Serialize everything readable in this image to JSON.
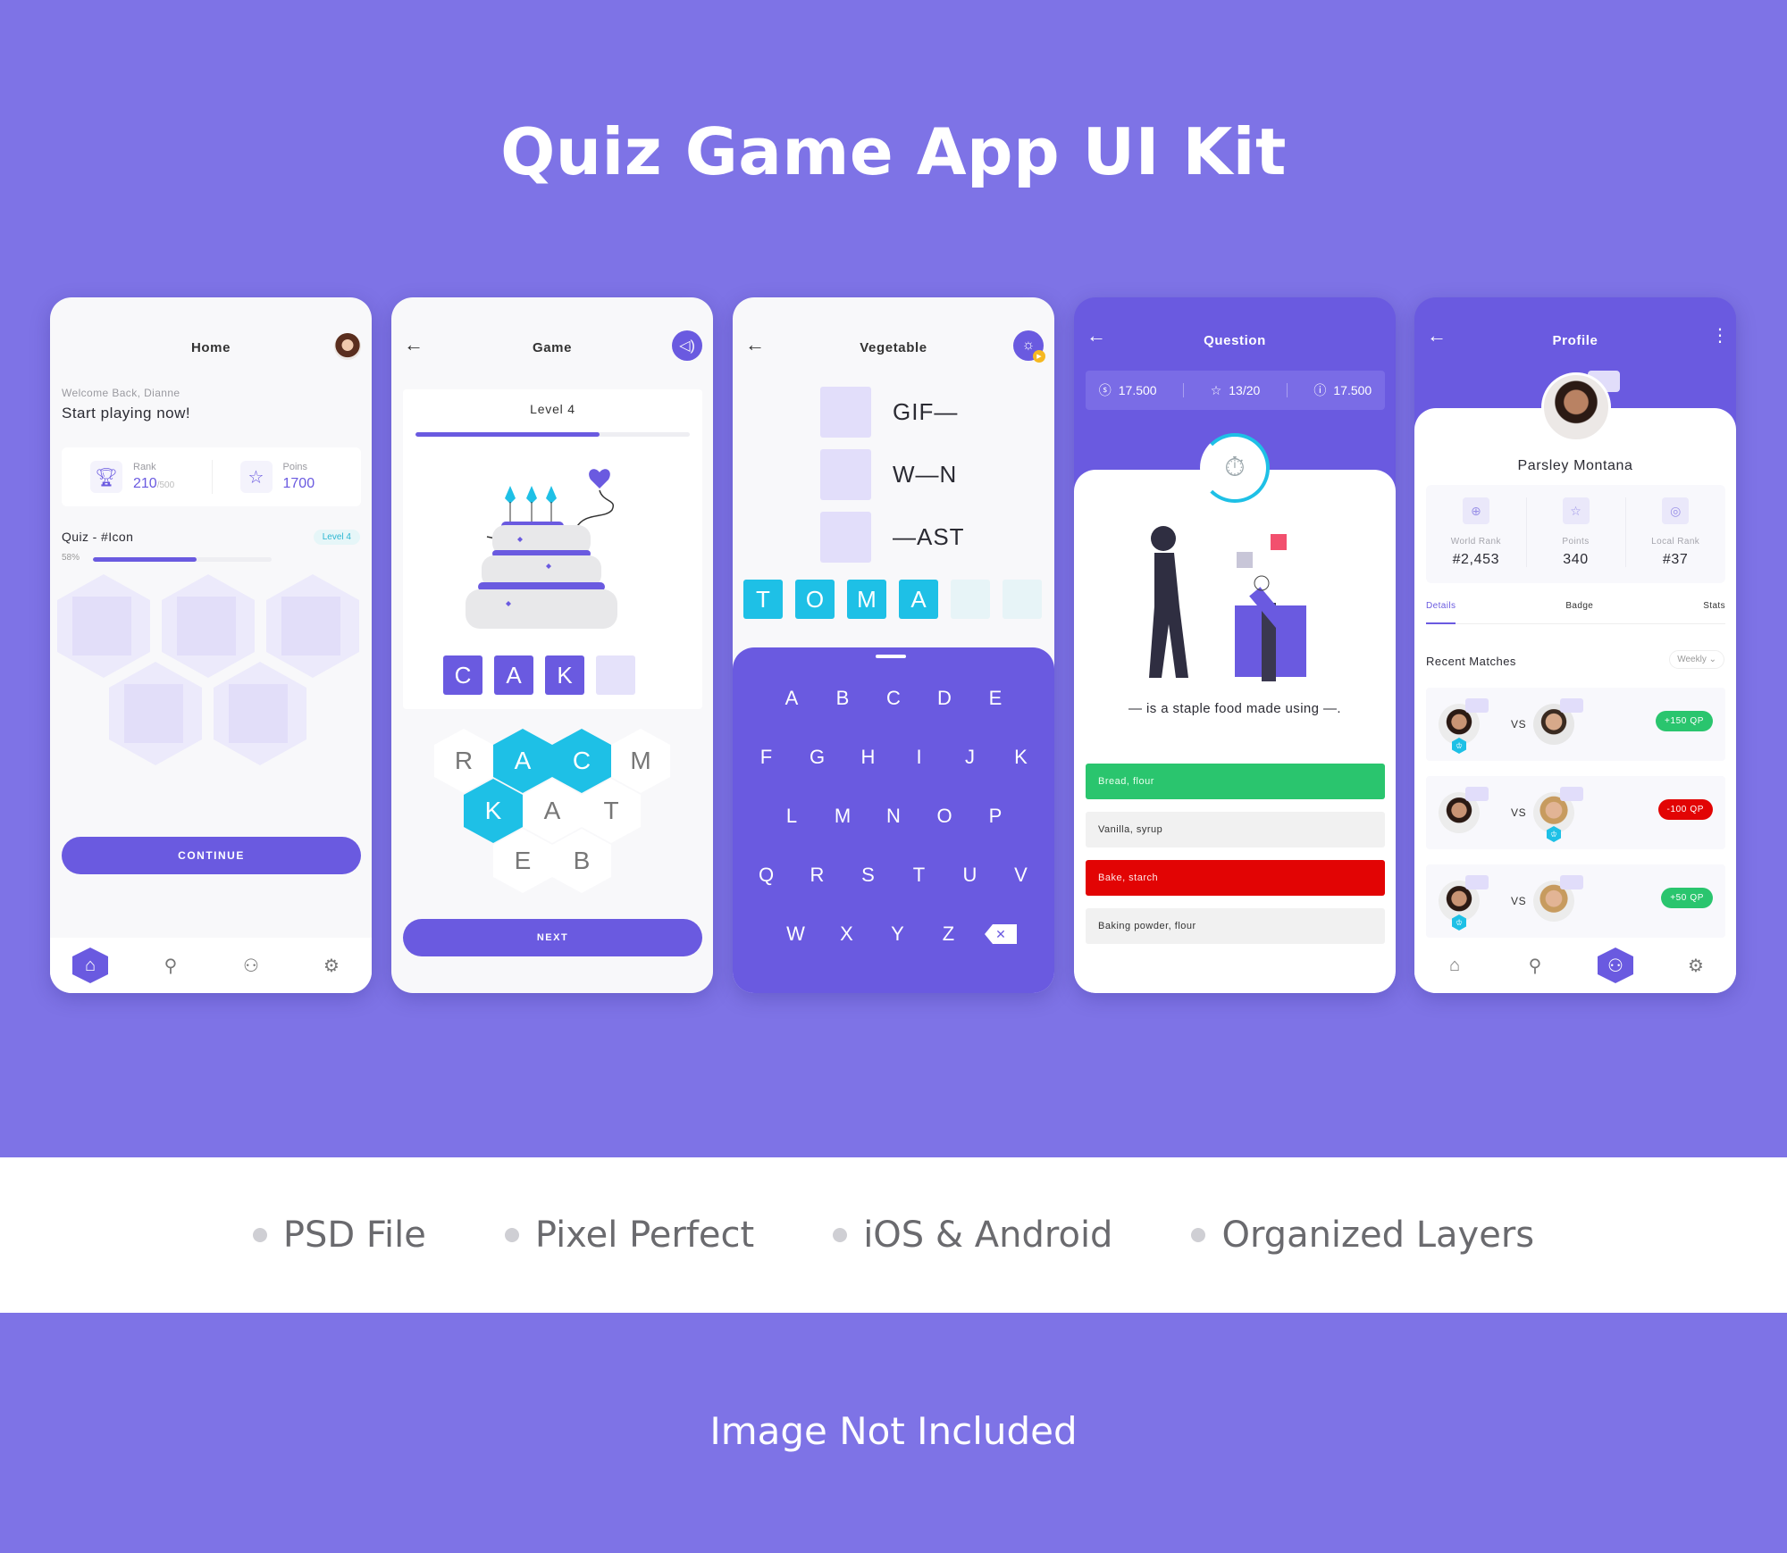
{
  "page": {
    "title": "Quiz Game App UI Kit",
    "features": [
      "PSD File",
      "Pixel Perfect",
      "iOS & Android",
      "Organized Layers"
    ],
    "footer_note": "Image Not Included",
    "colors": {
      "brand": "#6a5ae0",
      "background": "#7e73e6",
      "accent_cyan": "#1ec0e6",
      "correct": "#2ac56e",
      "wrong": "#e20404"
    }
  },
  "home": {
    "title": "Home",
    "menu_icon": "hamburger-icon",
    "welcome": "Welcome Back, Dianne",
    "headline": "Start playing now!",
    "stats": [
      {
        "icon": "trophy-icon",
        "label": "Rank",
        "value": "210",
        "suffix": "/500"
      },
      {
        "icon": "star-icon",
        "label": "Poins",
        "value": "1700",
        "suffix": ""
      }
    ],
    "quiz_title": "Quiz - #Icon",
    "level_badge": "Level 4",
    "progress_label": "58%",
    "progress": 0.58,
    "continue_label": "CONTINUE",
    "tabs": [
      {
        "icon": "home-icon",
        "glyph": "⌂",
        "active": true
      },
      {
        "icon": "search-icon",
        "glyph": "⚲",
        "active": false
      },
      {
        "icon": "user-icon",
        "glyph": "👤",
        "active": false
      },
      {
        "icon": "gear-icon",
        "glyph": "⚙",
        "active": false
      }
    ]
  },
  "game": {
    "title": "Game",
    "back_icon": "←",
    "sound_icon": "🔊",
    "level_title": "Level 4",
    "progress": 0.67,
    "answer_tiles": [
      "C",
      "A",
      "K",
      ""
    ],
    "hex_letters": [
      {
        "letter": "R",
        "selected": false
      },
      {
        "letter": "A",
        "selected": true
      },
      {
        "letter": "C",
        "selected": true
      },
      {
        "letter": "M",
        "selected": false
      },
      {
        "letter": "K",
        "selected": true
      },
      {
        "letter": "A",
        "selected": false
      },
      {
        "letter": "T",
        "selected": false
      },
      {
        "letter": "E",
        "selected": false
      },
      {
        "letter": "B",
        "selected": false
      }
    ],
    "next_label": "NEXT"
  },
  "vegetable": {
    "title": "Vegetable",
    "back_icon": "←",
    "hint_icon": "💡",
    "clues": [
      "GIF—",
      "W—N",
      "—AST"
    ],
    "answer_tiles": [
      "T",
      "O",
      "M",
      "A",
      "",
      ""
    ],
    "keyboard_rows": [
      [
        "A",
        "B",
        "C",
        "D",
        "E"
      ],
      [
        "F",
        "G",
        "H",
        "I",
        "J",
        "K"
      ],
      [
        "L",
        "M",
        "N",
        "O",
        "P"
      ],
      [
        "Q",
        "R",
        "S",
        "T",
        "U",
        "V"
      ],
      [
        "W",
        "X",
        "Y",
        "Z"
      ]
    ],
    "delete_icon": "✕"
  },
  "question": {
    "title": "Question",
    "back_icon": "←",
    "stats": [
      {
        "icon": "coin-icon",
        "glyph": "$",
        "value": "17.500"
      },
      {
        "icon": "star-icon",
        "glyph": "☆",
        "value": "13/20"
      },
      {
        "icon": "help-icon",
        "glyph": "?",
        "value": "17.500"
      }
    ],
    "timer_icon": "⏱",
    "question_text": "— is a staple food made using —.",
    "answers": [
      {
        "label": "Bread, flour",
        "state": "correct"
      },
      {
        "label": "Vanilla, syrup",
        "state": "neutral"
      },
      {
        "label": "Bake, starch",
        "state": "wrong"
      },
      {
        "label": "Baking powder, flour",
        "state": "neutral"
      }
    ]
  },
  "profile": {
    "title": "Profile",
    "back_icon": "←",
    "menu_icon": "⋮",
    "name": "Parsley Montana",
    "stats": [
      {
        "icon": "globe-icon",
        "glyph": "⊕",
        "label": "World Rank",
        "value": "#2,453"
      },
      {
        "icon": "star-icon",
        "glyph": "☆",
        "label": "Points",
        "value": "340"
      },
      {
        "icon": "location-icon",
        "glyph": "◎",
        "label": "Local Rank",
        "value": "#37"
      }
    ],
    "tabs": [
      "Details",
      "Badge",
      "Stats"
    ],
    "active_tab": "Details",
    "recent_title": "Recent Matches",
    "filter": "Weekly",
    "matches": [
      {
        "vs": "VS",
        "result": "+150 QP",
        "outcome": "win",
        "winner": "left"
      },
      {
        "vs": "VS",
        "result": "-100 QP",
        "outcome": "loss",
        "winner": "right"
      },
      {
        "vs": "VS",
        "result": "+50 QP",
        "outcome": "win",
        "winner": "left"
      }
    ],
    "tabs_nav": [
      {
        "icon": "home-icon",
        "glyph": "⌂",
        "active": false
      },
      {
        "icon": "search-icon",
        "glyph": "⚲",
        "active": false
      },
      {
        "icon": "user-icon",
        "glyph": "👤",
        "active": true
      },
      {
        "icon": "gear-icon",
        "glyph": "⚙",
        "active": false
      }
    ]
  }
}
